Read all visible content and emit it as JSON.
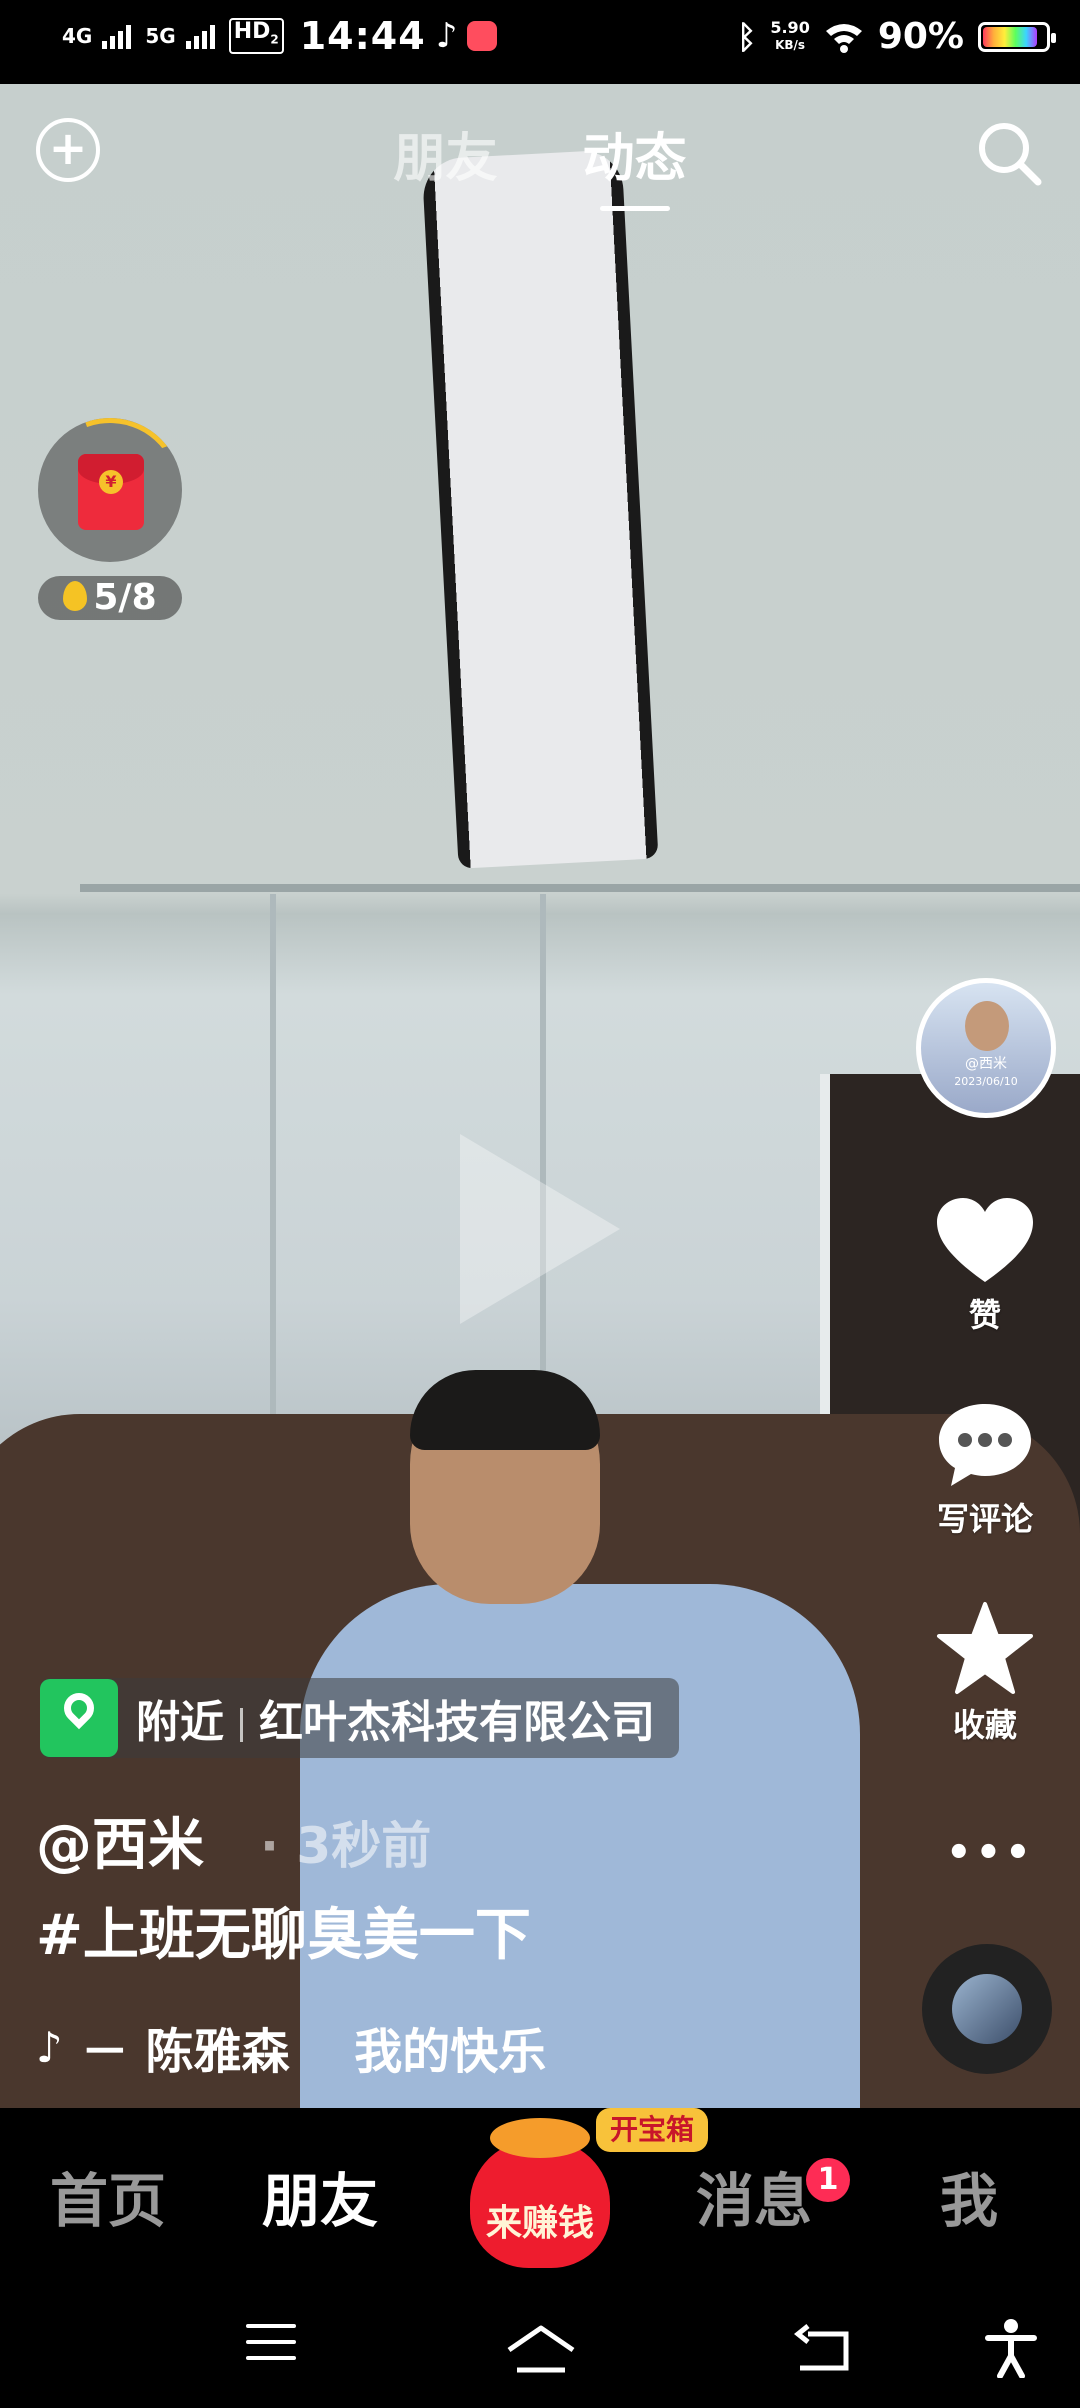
{
  "status_bar": {
    "net1": "4G",
    "net2": "5G",
    "hd": "HD",
    "hd_sub": "2",
    "time": "14:44",
    "speed_value": "5.90",
    "speed_unit": "KB/s",
    "battery_pct": "90%",
    "battery_level": 0.9
  },
  "top_nav": {
    "tabs": [
      {
        "label": "朋友",
        "active": false
      },
      {
        "label": "动态",
        "active": true
      }
    ]
  },
  "red_packet": {
    "coin_symbol": "¥",
    "count": "5/8"
  },
  "video": {
    "playing": false,
    "avatar_caption_name": "@西米",
    "avatar_caption_date": "2023/06/10"
  },
  "right_rail": {
    "like_label": "赞",
    "comment_label": "写评论",
    "favorite_label": "收藏",
    "more_label": "•••"
  },
  "caption": {
    "location_label": "附近",
    "location_name": "红叶杰科技有限公司",
    "author": "@西米",
    "time_ago": "· 3秒前",
    "hashtag": "#上班无聊臭美一下",
    "music": "－ 陈雅森　 我的快乐"
  },
  "bottom_nav": {
    "home": "首页",
    "friends": "朋友",
    "earn": "来赚钱",
    "chest": "开宝箱",
    "messages": "消息",
    "messages_badge": "1",
    "me": "我"
  },
  "colors": {
    "accent_red": "#fe2c55",
    "location_green": "#22c55e",
    "gold": "#f8c23a"
  }
}
